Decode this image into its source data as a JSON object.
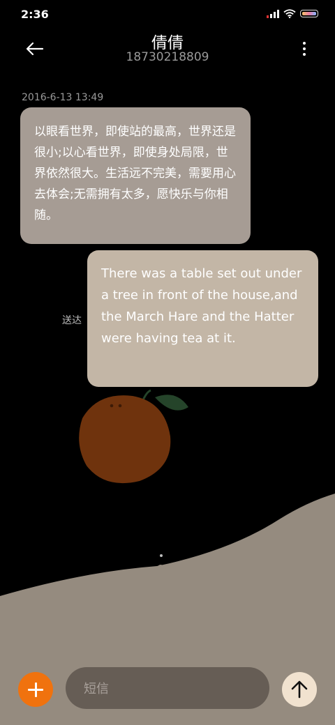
{
  "status_bar": {
    "time": "2:36",
    "icons": [
      "signal-icon",
      "wifi-icon",
      "battery-icon"
    ]
  },
  "header": {
    "contact_name": "倩倩",
    "phone_number": "18730218809",
    "back_icon": "back-arrow-icon",
    "menu_icon": "more-vertical-icon"
  },
  "conversation": {
    "timestamp": "2016-6-13 13:49",
    "received_message": "以眼看世界，即使站的最高，世界还是很小;以心看世界，即使身处局限，世界依然很大。生活远不完美，需要用心去体会;无需拥有太多，愿快乐与你相随。",
    "sent_message": "There was a table set out under a tree in front of the house,and the March Hare and the Hatter were having tea at it.",
    "sent_status": "送达"
  },
  "composer": {
    "placeholder": "短信",
    "add_icon": "plus-icon",
    "send_icon": "arrow-up-icon"
  },
  "colors": {
    "received_bubble": "#a69c94",
    "sent_bubble": "#c3b6a6",
    "add_button": "#f0720e",
    "send_button": "#f1e2cf",
    "input": "#665d55",
    "hill": "#958b7f"
  }
}
